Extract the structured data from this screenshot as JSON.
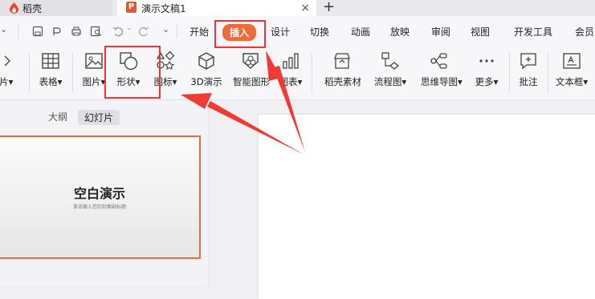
{
  "tabs": {
    "first": "稻壳",
    "active": "演示文稿1",
    "close": "×",
    "new": "+"
  },
  "menu": {
    "items": [
      "开始",
      "插入",
      "设计",
      "切换",
      "动画",
      "放映",
      "审阅",
      "视图",
      "开发工具",
      "会员"
    ],
    "active_index": 1
  },
  "ribbon": {
    "items": [
      {
        "label": "汀片",
        "icon": "media-icon"
      },
      {
        "label": "表格",
        "icon": "table-icon"
      },
      {
        "label": "图片",
        "icon": "picture-icon"
      },
      {
        "label": "形状",
        "icon": "shape-icon"
      },
      {
        "label": "图标",
        "icon": "icons-icon"
      },
      {
        "label": "3D演示",
        "icon": "cube-icon"
      },
      {
        "label": "智能图形",
        "icon": "smartart-icon"
      },
      {
        "label": "图表",
        "icon": "chart-icon"
      },
      {
        "label": "稻壳素材",
        "icon": "store-icon"
      },
      {
        "label": "流程图",
        "icon": "flowchart-icon"
      },
      {
        "label": "思维导图",
        "icon": "mindmap-icon"
      },
      {
        "label": "更多",
        "icon": "more-icon"
      },
      {
        "label": "批注",
        "icon": "comment-icon"
      },
      {
        "label": "文本框",
        "icon": "textbox-icon"
      }
    ]
  },
  "leftpanel": {
    "outline_tab": "大纲",
    "slides_tab": "幻灯片",
    "thumb_title": "空白演示",
    "thumb_subtitle": "单击输入您的封面副标题"
  },
  "annotations": {
    "color": "#e53935"
  }
}
